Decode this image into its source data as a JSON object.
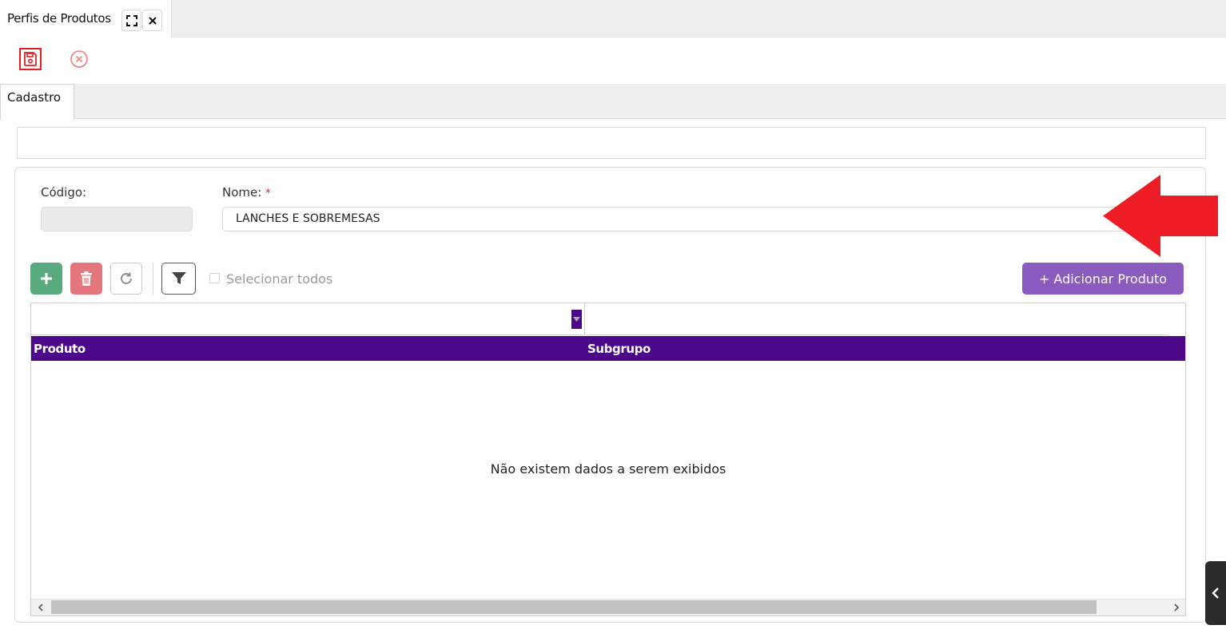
{
  "window": {
    "tab_title": "Perfis de Produtos",
    "expand_icon": "expand-icon",
    "close_icon": "close-icon"
  },
  "toolbar": {
    "save_icon": "save-icon",
    "cancel_icon": "cancel-circle-icon"
  },
  "section_tabs": [
    {
      "label": "Cadastro",
      "active": true
    }
  ],
  "form": {
    "codigo": {
      "label": "Código:",
      "value": ""
    },
    "nome": {
      "label": "Nome:",
      "required_mark": "*",
      "value": "LANCHES E SOBREMESAS"
    }
  },
  "annotation": {
    "arrow_color": "#ee1c25"
  },
  "grid": {
    "select_all_label": "Selecionar todos",
    "add_product_label": "+ Adicionar Produto",
    "columns": [
      {
        "label": "Produto"
      },
      {
        "label": "Subgrupo"
      }
    ],
    "empty_message": "Não existem dados a serem exibidos",
    "header_color": "#4b0888"
  },
  "colors": {
    "accent_purple": "#8a5cc0",
    "add_green": "#5aaa80",
    "delete_red": "#e4767e"
  }
}
